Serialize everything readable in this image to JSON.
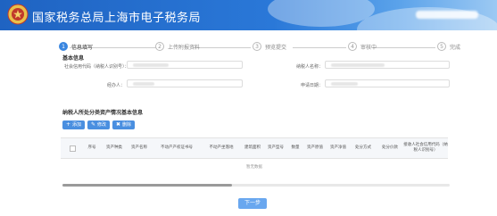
{
  "header": {
    "title": "国家税务总局上海市电子税务局",
    "logo_icon": "tax-emblem-icon",
    "brand_color": "#2a78d8"
  },
  "steps": [
    {
      "num": "1",
      "label": "信息填写",
      "active": true
    },
    {
      "num": "2",
      "label": "上传附报资料",
      "active": false
    },
    {
      "num": "3",
      "label": "预览提交",
      "active": false
    },
    {
      "num": "4",
      "label": "审核中",
      "active": false
    },
    {
      "num": "5",
      "label": "完成",
      "active": false
    }
  ],
  "basic_info": {
    "section_title": "基本信息",
    "credit_code_label": "社会信用代码（纳税人识别号）：",
    "taxpayer_name_label": "纳税人名称：",
    "agent_label": "经办人：",
    "apply_date_label": "申请日期："
  },
  "asset_section": {
    "title": "纳税人所处分类资产情况基本信息",
    "buttons": [
      {
        "label": "添加",
        "icon": "plus-icon"
      },
      {
        "label": "修改",
        "icon": "edit-icon"
      },
      {
        "label": "删除",
        "icon": "trash-icon"
      }
    ],
    "columns": [
      "序号",
      "资产种类",
      "资产名称",
      "不动产产权证书号",
      "不动产坐落地",
      "建筑面积",
      "资产型号",
      "数量",
      "资产原值",
      "资产净值",
      "处分方式",
      "处分价款",
      "接收人社会信用代码（纳税人识别号）"
    ],
    "empty_text": "暂无数据"
  },
  "footer": {
    "next_label": "下一步"
  }
}
